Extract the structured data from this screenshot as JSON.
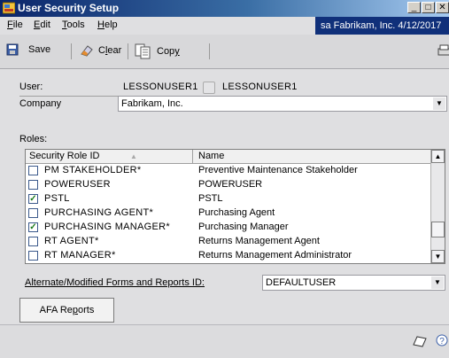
{
  "window": {
    "title": "User Security Setup"
  },
  "menu": {
    "items": [
      {
        "label": "File",
        "u": "F",
        "rest": "ile"
      },
      {
        "label": "Edit",
        "u": "E",
        "rest": "dit"
      },
      {
        "label": "Tools",
        "u": "T",
        "rest": "ools"
      },
      {
        "label": "Help",
        "u": "H",
        "rest": "elp"
      }
    ]
  },
  "session": {
    "text": "sa  Fabrikam, Inc.  4/12/2017"
  },
  "toolbar": {
    "save_label": "Save",
    "clear_pre": "C",
    "clear_u": "l",
    "clear_post": "ear",
    "copy_pre": "Cop",
    "copy_u": "y"
  },
  "header": {
    "user_label": "User:",
    "user_id": "LESSONUSER1",
    "user_name": "LESSONUSER1",
    "company_label": "Company",
    "company_value": "Fabrikam, Inc."
  },
  "roles": {
    "label": "Roles:",
    "col_id": "Security Role ID",
    "col_name": "Name",
    "rows": [
      {
        "id": "PM STAKEHOLDER*",
        "name": "Preventive Maintenance Stakeholder",
        "checked": false
      },
      {
        "id": "POWERUSER",
        "name": "POWERUSER",
        "checked": false
      },
      {
        "id": "PSTL",
        "name": "PSTL",
        "checked": true
      },
      {
        "id": "PURCHASING AGENT*",
        "name": "Purchasing Agent",
        "checked": false
      },
      {
        "id": "PURCHASING MANAGER*",
        "name": "Purchasing Manager",
        "checked": true
      },
      {
        "id": "RT AGENT*",
        "name": "Returns Management Agent",
        "checked": false
      },
      {
        "id": "RT MANAGER*",
        "name": "Returns Management Administrator",
        "checked": false
      }
    ]
  },
  "alt_forms": {
    "label": "Alternate/Modified Forms and Reports ID:",
    "value": "DEFAULTUSER"
  },
  "afa": {
    "pre": "AFA Re",
    "u": "p",
    "post": "orts"
  },
  "colors": {
    "title_start": "#0a246a",
    "title_end": "#a6caf0",
    "check": "#1b7a1b"
  }
}
